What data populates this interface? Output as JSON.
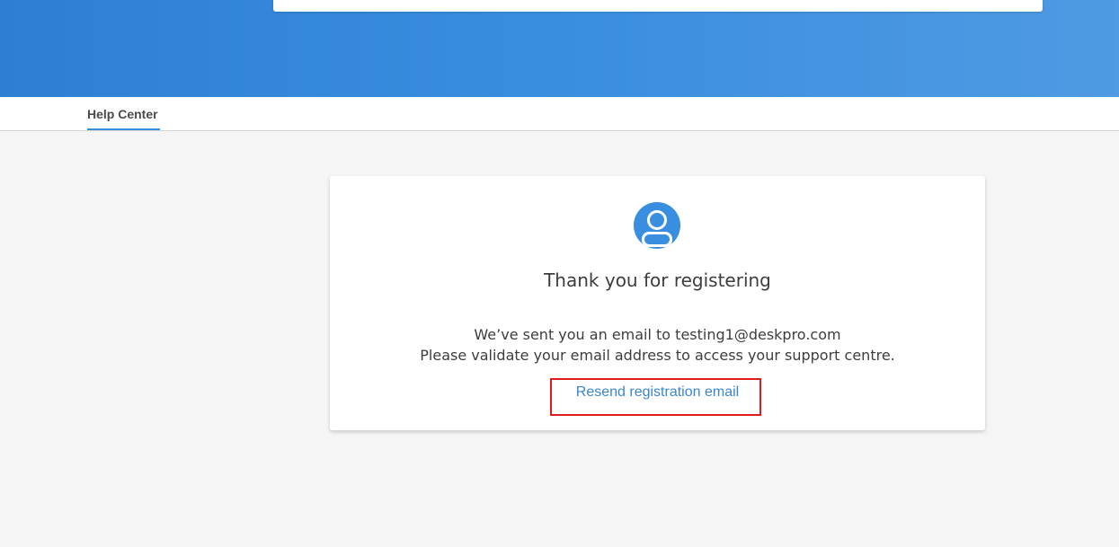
{
  "nav": {
    "help_center_label": "Help Center"
  },
  "card": {
    "icon": "user-avatar-icon",
    "title": "Thank you for registering",
    "message_line1": "We’ve sent you an email to testing1@deskpro.com",
    "message_line2": "Please validate your email address to access your support centre.",
    "resend_label": "Resend registration email"
  },
  "colors": {
    "brand_blue": "#3a8ee0",
    "link_blue": "#3a86d2",
    "highlight_red": "#e11b1b"
  }
}
